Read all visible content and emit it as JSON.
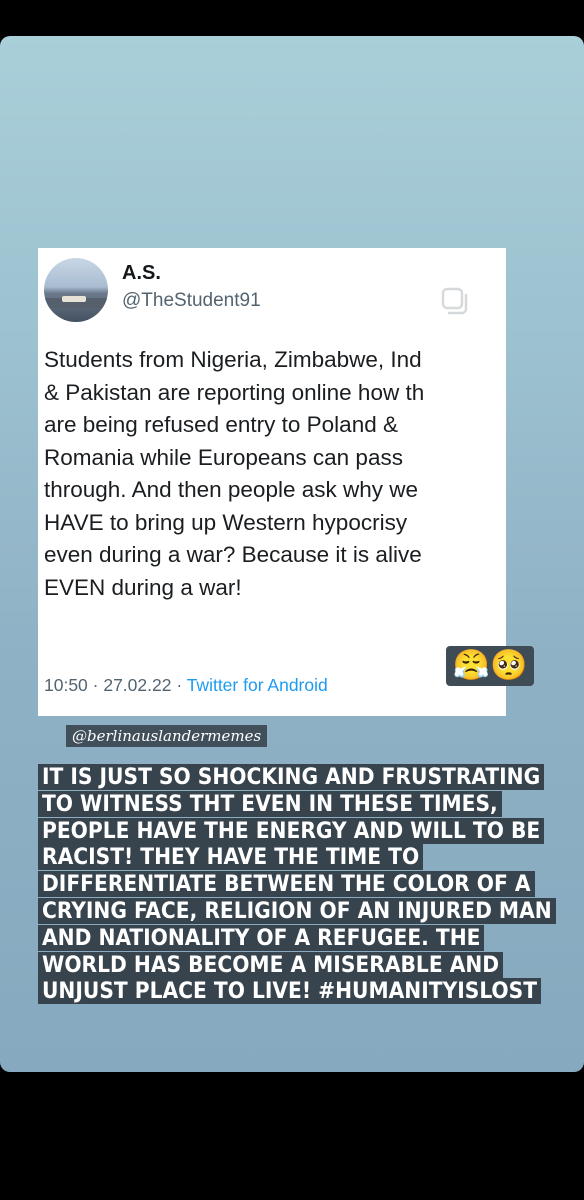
{
  "tweet": {
    "display_name": "A.S.",
    "handle": "@TheStudent91",
    "text": "Students from Nigeria, Zimbabwe, Ind\n& Pakistan are reporting online how th\nare being refused entry to Poland &\nRomania while Europeans can pass\nthrough. And then people ask why we\nHAVE to bring up Western hypocrisy\neven during a war? Because it is alive\nEVEN during a war!",
    "timestamp": "10:50 · 27.02.22 · ",
    "source": "Twitter for Android"
  },
  "stickers": {
    "emojis": "😤🥺"
  },
  "watermark": "@berlinauslandermemes",
  "caption": "IT IS JUST SO SHOCKING AND FRUSTRATING TO WITNESS THT EVEN IN THESE TIMES, PEOPLE HAVE THE ENERGY AND WILL TO BE RACIST! THEY HAVE THE TIME TO DIFFERENTIATE BETWEEN THE COLOR OF A CRYING FACE, RELIGION OF AN INJURED MAN AND NATIONALITY OF A REFUGEE. THE WORLD HAS BECOME A MISERABLE AND UNJUST PLACE TO LIVE! #HUMANITYISLOST",
  "icons": {
    "copy": "copy-icon"
  }
}
